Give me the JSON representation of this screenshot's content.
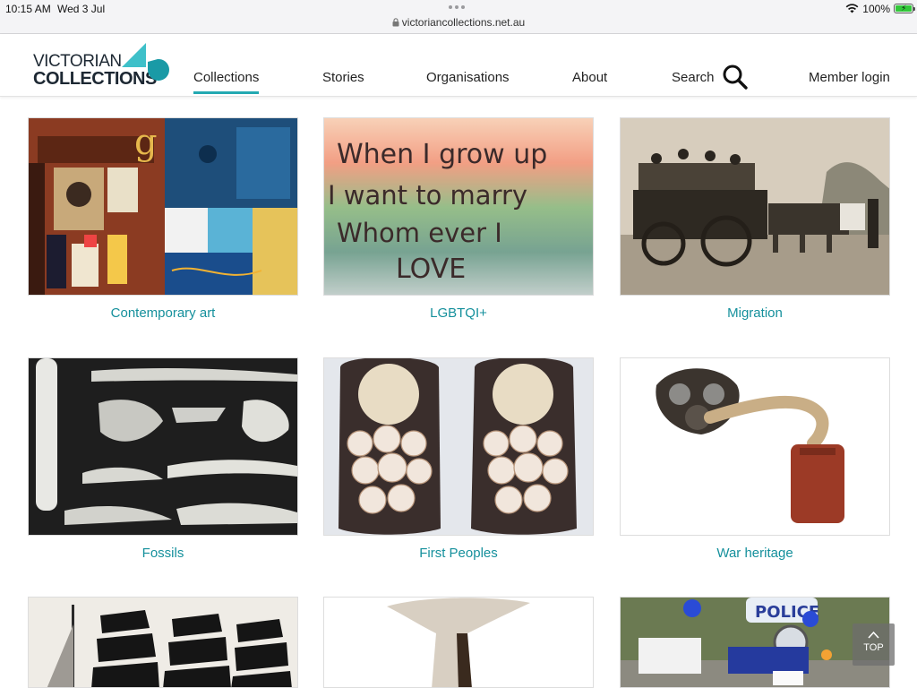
{
  "status": {
    "time": "10:15 AM",
    "date": "Wed 3 Jul",
    "battery_pct": "100%",
    "battery_level": 1.0,
    "url": "victoriancollections.net.au"
  },
  "site": {
    "logo_line1": "VICTORIAN",
    "logo_line2": "COLLECTIONS",
    "accent_color": "#23a9b2",
    "link_color": "#15909c"
  },
  "nav": {
    "collections": "Collections",
    "stories": "Stories",
    "organisations": "Organisations",
    "about": "About",
    "search": "Search",
    "member_login": "Member login",
    "active": "Collections"
  },
  "collections": [
    {
      "label": "Contemporary art",
      "image": "artwork-collage"
    },
    {
      "label": "LGBTQI+",
      "image": "painted-text-artwork"
    },
    {
      "label": "Migration",
      "image": "horse-drawn-coach-photo"
    },
    {
      "label": "Fossils",
      "image": "fossil-bones-photo"
    },
    {
      "label": "First Peoples",
      "image": "shell-slippers-photo"
    },
    {
      "label": "War heritage",
      "image": "gas-mask-photo"
    },
    {
      "label": "",
      "image": "sailing-ship-photo"
    },
    {
      "label": "",
      "image": "wooden-object-photo"
    },
    {
      "label": "",
      "image": "police-motorcycle-photo"
    }
  ],
  "painted_text": {
    "line1": "When I grow up",
    "line2": "I want to marry",
    "line3": "Whom ever I",
    "line4": "LOVE"
  },
  "police_text": "POLICE",
  "totop_label": "TOP"
}
